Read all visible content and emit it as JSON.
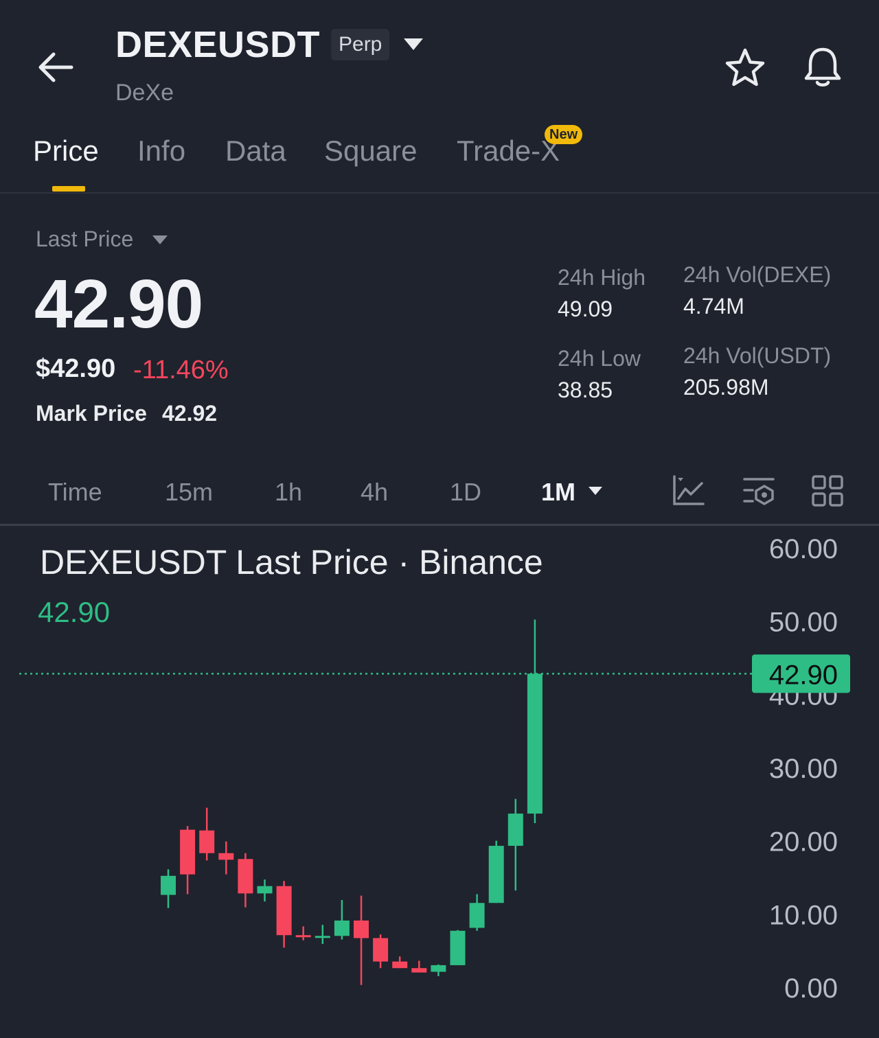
{
  "header": {
    "symbol": "DEXEUSDT",
    "badge": "Perp",
    "name": "DeXe",
    "back_icon": "back-arrow-icon",
    "symbol_dropdown_icon": "caret-down-icon",
    "favorite_icon": "star-icon",
    "alert_icon": "bell-icon"
  },
  "tabs": [
    {
      "label": "Price",
      "active": true
    },
    {
      "label": "Info"
    },
    {
      "label": "Data"
    },
    {
      "label": "Square"
    },
    {
      "label": "Trade-X",
      "badge": "New"
    }
  ],
  "price": {
    "label": "Last Price",
    "last": "42.90",
    "usd": "$42.90",
    "change": "-11.46%",
    "mark_label": "Mark Price",
    "mark_value": "42.92"
  },
  "stats": {
    "high_label": "24h High",
    "high": "49.09",
    "low_label": "24h Low",
    "low": "38.85",
    "vol_dexe_label": "24h Vol(DEXE)",
    "vol_dexe": "4.74M",
    "vol_usdt_label": "24h Vol(USDT)",
    "vol_usdt": "205.98M"
  },
  "intervals": {
    "items": [
      "Time",
      "15m",
      "1h",
      "4h",
      "1D",
      "1M"
    ],
    "active": "1M",
    "icons": [
      "indicator-chart-icon",
      "chart-settings-icon",
      "grid-layout-icon"
    ]
  },
  "colors": {
    "up": "#2ebd85",
    "down": "#f6465d",
    "accent": "#f0b90b",
    "background": "#1f232d"
  },
  "chart_data": {
    "type": "candlestick",
    "title": "DEXEUSDT Last Price · Binance",
    "last_value_label": "42.90",
    "price_tag": "42.90",
    "last_price": 42.9,
    "ylim": [
      0,
      60
    ],
    "y_ticks": [
      "0.00",
      "10.00",
      "20.00",
      "30.00",
      "40.00",
      "50.00",
      "60.00"
    ],
    "candles": [
      {
        "o": 12.7,
        "h": 16.2,
        "l": 10.9,
        "c": 15.3
      },
      {
        "o": 21.6,
        "h": 22.1,
        "l": 12.8,
        "c": 15.5
      },
      {
        "o": 21.5,
        "h": 24.6,
        "l": 17.4,
        "c": 18.4
      },
      {
        "o": 18.4,
        "h": 20.0,
        "l": 15.5,
        "c": 17.5
      },
      {
        "o": 17.6,
        "h": 18.4,
        "l": 11.0,
        "c": 12.9
      },
      {
        "o": 12.9,
        "h": 14.8,
        "l": 11.8,
        "c": 13.9
      },
      {
        "o": 13.9,
        "h": 14.6,
        "l": 5.5,
        "c": 7.2
      },
      {
        "o": 7.2,
        "h": 8.4,
        "l": 6.5,
        "c": 7.0
      },
      {
        "o": 7.0,
        "h": 8.6,
        "l": 6.0,
        "c": 7.1
      },
      {
        "o": 7.1,
        "h": 12.0,
        "l": 6.6,
        "c": 9.2
      },
      {
        "o": 9.2,
        "h": 12.6,
        "l": 0.4,
        "c": 6.8
      },
      {
        "o": 6.8,
        "h": 7.3,
        "l": 2.7,
        "c": 3.6
      },
      {
        "o": 3.6,
        "h": 4.3,
        "l": 2.7,
        "c": 2.7
      },
      {
        "o": 2.7,
        "h": 3.7,
        "l": 2.2,
        "c": 2.1
      },
      {
        "o": 2.2,
        "h": 3.2,
        "l": 1.6,
        "c": 3.1
      },
      {
        "o": 3.1,
        "h": 7.9,
        "l": 3.1,
        "c": 7.8
      },
      {
        "o": 8.2,
        "h": 12.8,
        "l": 7.8,
        "c": 11.6
      },
      {
        "o": 11.6,
        "h": 20.1,
        "l": 11.6,
        "c": 19.4
      },
      {
        "o": 19.4,
        "h": 25.8,
        "l": 13.3,
        "c": 23.8
      },
      {
        "o": 23.8,
        "h": 50.3,
        "l": 22.5,
        "c": 42.9
      }
    ]
  }
}
